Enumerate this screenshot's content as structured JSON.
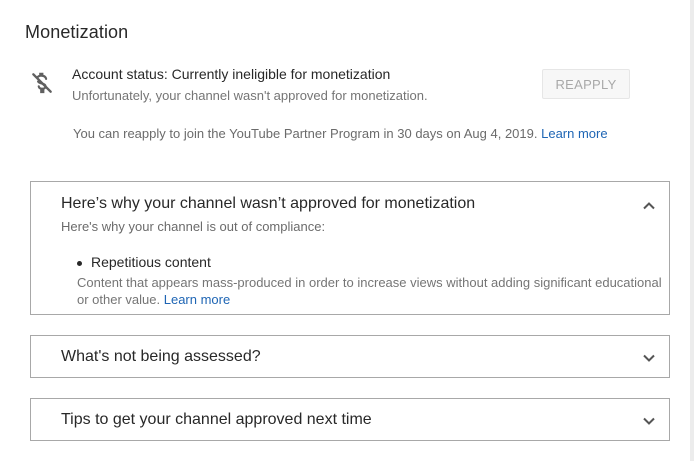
{
  "section": {
    "title": "Monetization"
  },
  "account": {
    "status_text": "Account status: Currently ineligible for monetization",
    "sub_text": "Unfortunately, your channel wasn't approved for monetization.",
    "status_icon": "no-dollar-icon",
    "reapply_label": "REAPPLY",
    "reapply_info": "You can reapply to join the YouTube Partner Program in 30 days on Aug 4, 2019.",
    "learn_more": "Learn more"
  },
  "panels": [
    {
      "title": "Here’s why your channel wasn’t approved for monetization",
      "subtitle": "Here's why your channel is out of compliance:",
      "expanded": true,
      "chevron_icon": "chevron-up-icon",
      "reasons": [
        {
          "title": "Repetitious content",
          "description": "Content that appears mass-produced in order to increase views without adding significant educational or other value.",
          "learn_more": "Learn more"
        }
      ]
    },
    {
      "title": "What's not being assessed?",
      "expanded": false,
      "chevron_icon": "chevron-down-icon"
    },
    {
      "title": "Tips to get your channel approved next time",
      "expanded": false,
      "chevron_icon": "chevron-down-icon"
    }
  ],
  "colors": {
    "text": "#282828",
    "muted": "#757575",
    "link": "#1e65b4",
    "border": "#a8a8a8",
    "button_bg": "#f7f7f7",
    "button_text": "#a8a8a8"
  }
}
